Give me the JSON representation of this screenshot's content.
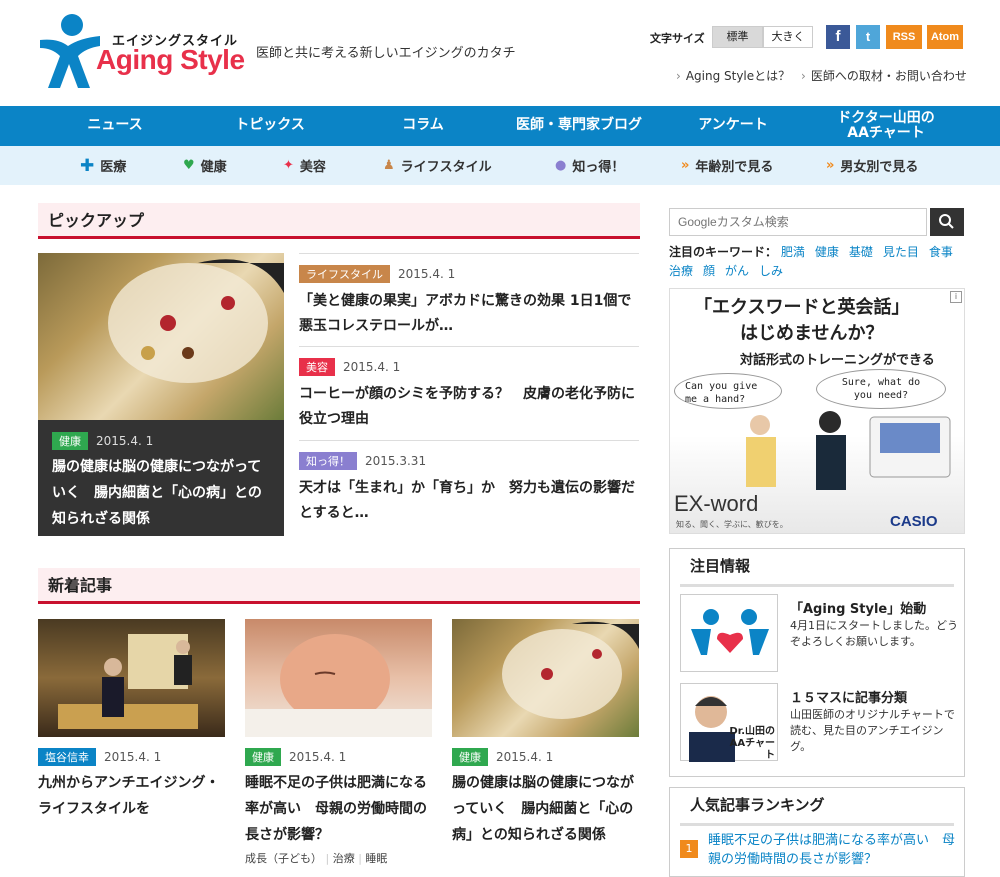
{
  "header": {
    "logo_kana": "エイジングスタイル",
    "logo_text": "Aging Style",
    "tagline": "医師と共に考える新しいエイジングのカタチ",
    "font_size_label": "文字サイズ",
    "font_size_standard": "標準",
    "font_size_large": "大きく",
    "social": {
      "facebook": "f",
      "twitter": "t",
      "rss": "RSS",
      "atom": "Atom"
    },
    "links": [
      "Aging Styleとは？",
      "医師への取材・お問い合わせ"
    ]
  },
  "nav_main": [
    "ニュース",
    "トピックス",
    "コラム",
    "医師・専門家ブログ",
    "アンケート",
    "ドクター山田のAAチャート"
  ],
  "nav_sub": [
    {
      "label": "医療",
      "icon": "plus-icon",
      "color": "#0b84c6"
    },
    {
      "label": "健康",
      "icon": "heart-icon",
      "color": "#2fa84f"
    },
    {
      "label": "美容",
      "icon": "sparkle-icon",
      "color": "#e8304a"
    },
    {
      "label": "ライフスタイル",
      "icon": "person-icon",
      "color": "#c8864a"
    },
    {
      "label": "知っ得！",
      "icon": "dot-icon",
      "color": "#8a7fd0"
    },
    {
      "label": "年齢別で見る",
      "icon": "chevron-down-icon",
      "color": "#f08a1c"
    },
    {
      "label": "男女別で見る",
      "icon": "chevron-down-icon",
      "color": "#f08a1c"
    }
  ],
  "pickup": {
    "heading": "ピックアップ",
    "feature": {
      "tag": "健康",
      "tag_color": "#2fa84f",
      "date": "2015.4. 1",
      "title": "腸の健康は脳の健康につながっていく　腸内細菌と「心の病」との知られざる関係"
    },
    "items": [
      {
        "tag": "ライフスタイル",
        "tag_color": "#c8864a",
        "date": "2015.4. 1",
        "title": "「美と健康の果実」アボカドに驚きの効果 1日1個で悪玉コレステロールが…"
      },
      {
        "tag": "美容",
        "tag_color": "#e8304a",
        "date": "2015.4. 1",
        "title": "コーヒーが顔のシミを予防する？　皮膚の老化予防に役立つ理由"
      },
      {
        "tag": "知っ得！",
        "tag_color": "#8a7fd0",
        "date": "2015.3.31",
        "title": "天才は「生まれ」か「育ち」か　努力も遺伝の影響だとすると…"
      }
    ]
  },
  "new_articles": {
    "heading": "新着記事",
    "items": [
      {
        "tag": "塩谷信幸",
        "tag_color": "#0b84c6",
        "date": "2015.4. 1",
        "title": "九州からアンチエイジング・ライフスタイルを",
        "keywords": []
      },
      {
        "tag": "健康",
        "tag_color": "#2fa84f",
        "date": "2015.4. 1",
        "title": "睡眠不足の子供は肥満になる率が高い　母親の労働時間の長さが影響？",
        "keywords": [
          "成長（子ども）",
          "治療",
          "睡眠"
        ]
      },
      {
        "tag": "健康",
        "tag_color": "#2fa84f",
        "date": "2015.4. 1",
        "title": "腸の健康は脳の健康につながっていく　腸内細菌と「心の病」との知られざる関係",
        "keywords": []
      }
    ]
  },
  "sidebar": {
    "search_placeholder": "Googleカスタム検索",
    "keyword_label": "注目のキーワード：",
    "keywords": [
      "肥満",
      "健康",
      "基礎",
      "見た目",
      "食事",
      "治療",
      "顔",
      "がん",
      "しみ"
    ],
    "ad": {
      "headline1": "「エクスワードと英会話」",
      "headline2": "はじめませんか？",
      "sub": "対話形式のトレーニングができる",
      "bubble1": "Can you give me a hand?",
      "bubble2": "Sure, what do you need?",
      "product": "EX-word",
      "product_sub": "知る、聞く、学ぶに、歓びを。",
      "brand": "CASIO"
    },
    "notice": {
      "heading": "注目情報",
      "items": [
        {
          "title": "「Aging Style」始動",
          "text": "4月1日にスタートしました。どうぞよろしくお願いします。"
        },
        {
          "title": "１５マスに記事分類",
          "text": "山田医師のオリジナルチャートで読む、見た目のアンチエイジング。",
          "thumb_label": "Dr.山田のAAチャート"
        }
      ]
    },
    "ranking": {
      "heading": "人気記事ランキング",
      "items": [
        {
          "rank": "1",
          "title": "睡眠不足の子供は肥満になる率が高い　母親の労働時間の長さが影響？"
        }
      ]
    }
  }
}
